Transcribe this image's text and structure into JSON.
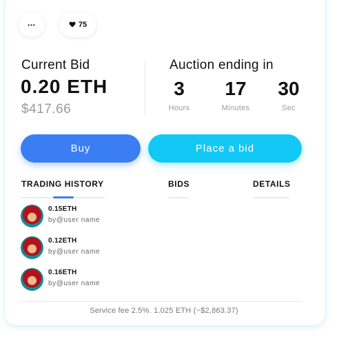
{
  "header": {
    "more_icon": "more-horizontal-icon",
    "more_label": "•••",
    "likes_icon": "heart-icon",
    "likes_count": "75"
  },
  "bid": {
    "label": "Current Bid",
    "eth": "0.20 ETH",
    "usd": "$417.66"
  },
  "auction": {
    "label": "Auction ending in",
    "countdown": [
      {
        "value": "3",
        "unit": "Hours"
      },
      {
        "value": "17",
        "unit": "Minutes"
      },
      {
        "value": "30",
        "unit": "Sec"
      }
    ]
  },
  "actions": {
    "buy_label": "Buy",
    "place_bid_label": "Place a bid"
  },
  "tabs": [
    {
      "label": "TRADING HISTORY",
      "active": true
    },
    {
      "label": "BIDS",
      "active": false
    },
    {
      "label": "DETAILS",
      "active": false
    }
  ],
  "history": [
    {
      "amount": "0.15ETH",
      "user": "by@user name"
    },
    {
      "amount": "0.12ETH",
      "user": "by@user name"
    },
    {
      "amount": "0.16ETH",
      "user": "by@user name"
    }
  ],
  "footer": {
    "service_fee": "Service fee 2.5%. 1.025 ETH (~$2,863.37)"
  },
  "colors": {
    "buy_button": "#3b7ef4",
    "bid_button": "#12c8f5",
    "accent_indicator": "#3b7ef4",
    "muted_text": "#9a9a9a"
  }
}
